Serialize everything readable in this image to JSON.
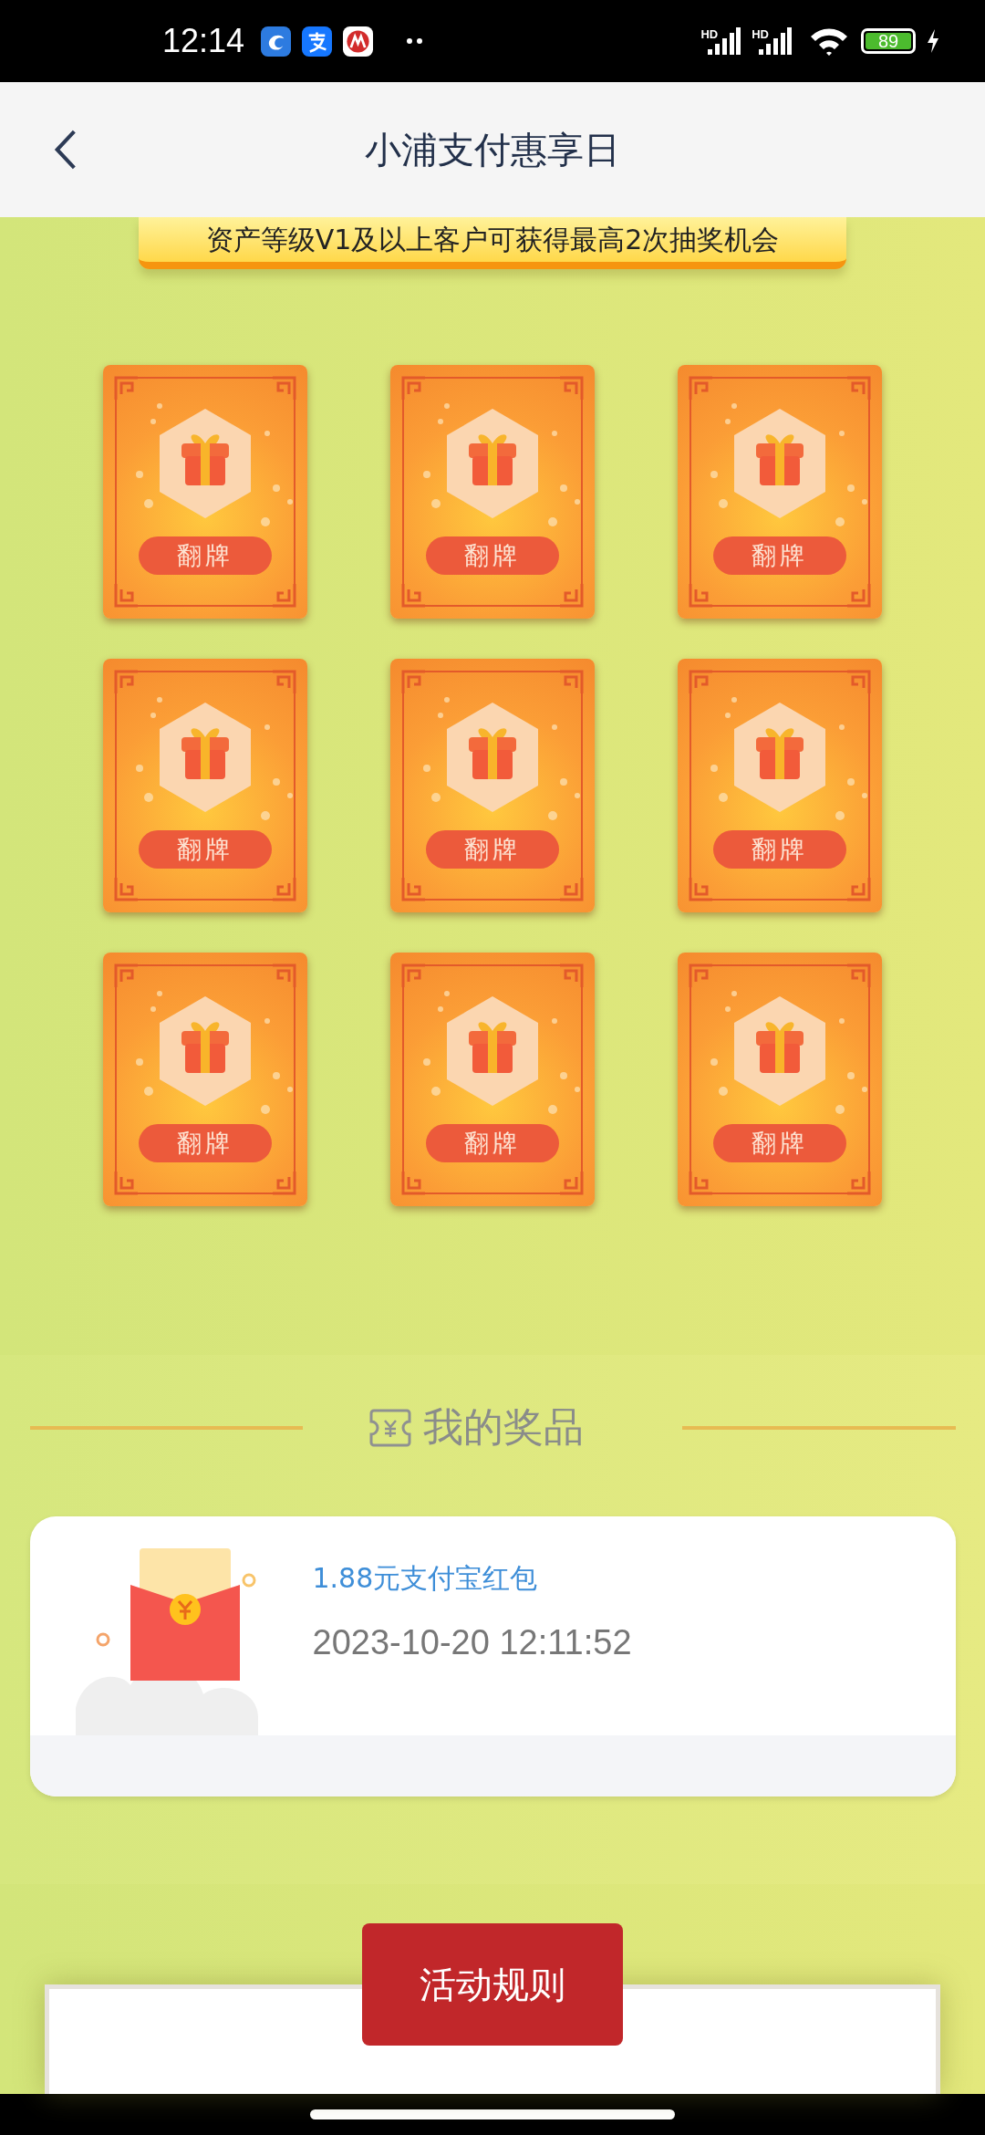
{
  "status_bar": {
    "time": "12:14",
    "network_labels": [
      "HD",
      "HD"
    ],
    "battery": "89"
  },
  "header": {
    "title": "小浦支付惠享日"
  },
  "banner": {
    "text": "资产等级V1及以上客户可获得最高2次抽奖机会"
  },
  "cards": [
    {
      "label": "翻牌"
    },
    {
      "label": "翻牌"
    },
    {
      "label": "翻牌"
    },
    {
      "label": "翻牌"
    },
    {
      "label": "翻牌"
    },
    {
      "label": "翻牌"
    },
    {
      "label": "翻牌"
    },
    {
      "label": "翻牌"
    },
    {
      "label": "翻牌"
    }
  ],
  "prizes_section": {
    "title": "我的奖品",
    "items": [
      {
        "name": "1.88元支付宝红包",
        "time": "2023-10-20 12:11:52"
      }
    ]
  },
  "rules": {
    "button": "活动规则"
  }
}
